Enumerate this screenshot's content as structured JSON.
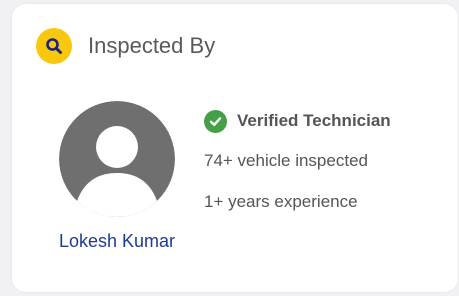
{
  "card": {
    "title": "Inspected By",
    "header_icon": "search-icon",
    "colors": {
      "badge": "#f9c80e",
      "name": "#1c3b92",
      "verified": "#43a047"
    }
  },
  "inspector": {
    "name": "Lokesh Kumar",
    "avatar_icon": "user-avatar-icon",
    "verified_label": "Verified Technician",
    "verified_icon": "check-circle-icon",
    "vehicles_inspected": "74+ vehicle inspected",
    "experience": "1+ years experience"
  }
}
